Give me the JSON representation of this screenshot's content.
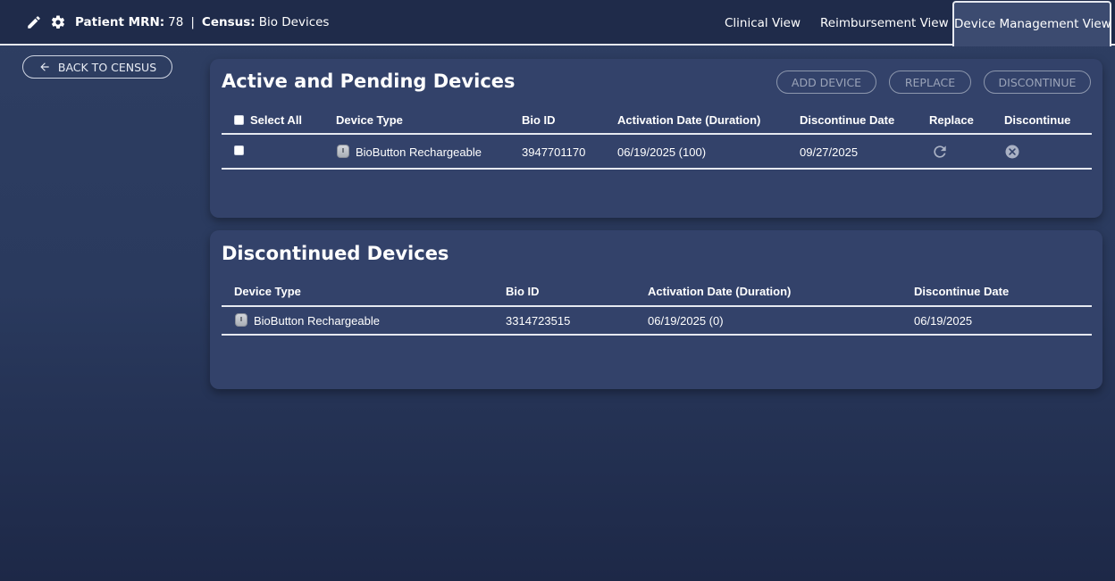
{
  "header": {
    "patient_mrn_label": "Patient MRN:",
    "patient_mrn_value": "78",
    "separator": "|",
    "census_label": "Census:",
    "census_value": "Bio Devices",
    "icons": [
      "edit-icon",
      "gear-icon"
    ]
  },
  "tabs": [
    {
      "label": "Clinical View",
      "active": false
    },
    {
      "label": "Reimbursement View",
      "active": false
    },
    {
      "label": "Device Management View",
      "active": true
    }
  ],
  "back_button": {
    "label": "BACK TO CENSUS",
    "icon": "arrow-left-icon"
  },
  "active_panel": {
    "title": "Active and Pending Devices",
    "buttons": {
      "add": "ADD DEVICE",
      "replace": "REPLACE",
      "discontinue": "DISCONTINUE"
    },
    "columns": [
      "Select All",
      "Device Type",
      "Bio ID",
      "Activation Date (Duration)",
      "Discontinue Date",
      "Replace",
      "Discontinue"
    ],
    "rows": [
      {
        "device_type": "BioButton Rechargeable",
        "bio_id": "3947701170",
        "activation": "06/19/2025 (100)",
        "discontinue_date": "09/27/2025",
        "replace_icon": "refresh-icon",
        "discontinue_icon": "close-circle-icon"
      }
    ]
  },
  "discontinued_panel": {
    "title": "Discontinued Devices",
    "columns": [
      "Device Type",
      "Bio ID",
      "Activation Date (Duration)",
      "Discontinue Date"
    ],
    "rows": [
      {
        "device_type": "BioButton Rechargeable",
        "bio_id": "3314723515",
        "activation": "06/19/2025 (0)",
        "discontinue_date": "06/19/2025"
      }
    ]
  },
  "colors": {
    "background": "#2a3a5e",
    "topbar": "#1f2b4a",
    "panel": "#33426a",
    "text": "#ffffff",
    "disabled_button": "#9aa3b8"
  }
}
